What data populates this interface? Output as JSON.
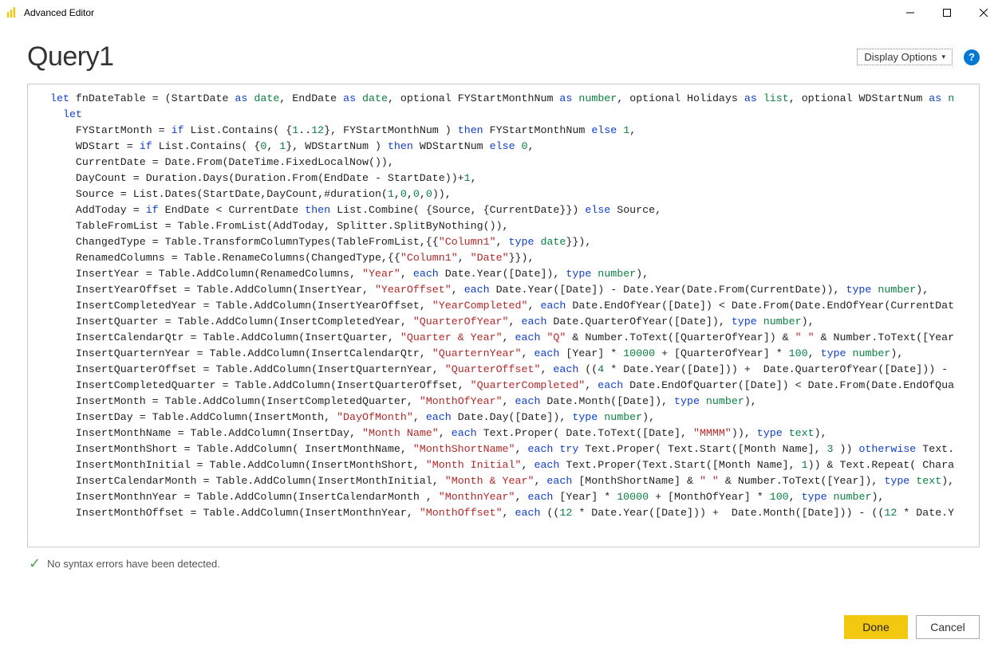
{
  "window": {
    "title": "Advanced Editor"
  },
  "header": {
    "query_name": "Query1",
    "display_options_label": "Display Options"
  },
  "status": {
    "message": "No syntax errors have been detected."
  },
  "buttons": {
    "done": "Done",
    "cancel": "Cancel"
  },
  "code": {
    "lines_html": [
      "<span class='kw'>let</span> fnDateTable = (StartDate <span class='kw'>as</span> <span class='ty'>date</span>, EndDate <span class='kw'>as</span> <span class='ty'>date</span>, optional FYStartMonthNum <span class='kw'>as</span> <span class='ty'>number</span>, optional Holidays <span class='kw'>as</span> <span class='ty'>list</span>, optional WDStartNum <span class='kw'>as</span> <span class='ty'>n</span>",
      "  <span class='kw'>let</span>",
      "    FYStartMonth = <span class='kw'>if</span> List.Contains( {<span class='num'>1</span>..<span class='num'>12</span>}, FYStartMonthNum ) <span class='kw'>then</span> FYStartMonthNum <span class='kw'>else</span> <span class='num'>1</span>,",
      "    WDStart = <span class='kw'>if</span> List.Contains( {<span class='num'>0</span>, <span class='num'>1</span>}, WDStartNum ) <span class='kw'>then</span> WDStartNum <span class='kw'>else</span> <span class='num'>0</span>,",
      "    CurrentDate = Date.From(DateTime.FixedLocalNow()),",
      "    DayCount = Duration.Days(Duration.From(EndDate - StartDate))+<span class='num'>1</span>,",
      "    Source = List.Dates(StartDate,DayCount,#duration(<span class='num'>1</span>,<span class='num'>0</span>,<span class='num'>0</span>,<span class='num'>0</span>)),",
      "    AddToday = <span class='kw'>if</span> EndDate &lt; CurrentDate <span class='kw'>then</span> List.Combine( {Source, {CurrentDate}}) <span class='kw'>else</span> Source,",
      "    TableFromList = Table.FromList(AddToday, Splitter.SplitByNothing()),",
      "    ChangedType = Table.TransformColumnTypes(TableFromList,{{<span class='str'>\"Column1\"</span>, <span class='kw'>type</span> <span class='ty'>date</span>}}),",
      "    RenamedColumns = Table.RenameColumns(ChangedType,{{<span class='str'>\"Column1\"</span>, <span class='str'>\"Date\"</span>}}),",
      "    InsertYear = Table.AddColumn(RenamedColumns, <span class='str'>\"Year\"</span>, <span class='kw'>each</span> Date.Year([Date]), <span class='kw'>type</span> <span class='ty'>number</span>),",
      "    InsertYearOffset = Table.AddColumn(InsertYear, <span class='str'>\"YearOffset\"</span>, <span class='kw'>each</span> Date.Year([Date]) - Date.Year(Date.From(CurrentDate)), <span class='kw'>type</span> <span class='ty'>number</span>),",
      "    InsertCompletedYear = Table.AddColumn(InsertYearOffset, <span class='str'>\"YearCompleted\"</span>, <span class='kw'>each</span> Date.EndOfYear([Date]) &lt; Date.From(Date.EndOfYear(CurrentDat",
      "",
      "    InsertQuarter = Table.AddColumn(InsertCompletedYear, <span class='str'>\"QuarterOfYear\"</span>, <span class='kw'>each</span> Date.QuarterOfYear([Date]), <span class='kw'>type</span> <span class='ty'>number</span>),",
      "    InsertCalendarQtr = Table.AddColumn(InsertQuarter, <span class='str'>\"Quarter &amp; Year\"</span>, <span class='kw'>each</span> <span class='str'>\"Q\"</span> &amp; Number.ToText([QuarterOfYear]) &amp; <span class='str'>\" \"</span> &amp; Number.ToText([Year",
      "    InsertQuarternYear = Table.AddColumn(InsertCalendarQtr, <span class='str'>\"QuarternYear\"</span>, <span class='kw'>each</span> [Year] * <span class='num'>10000</span> + [QuarterOfYear] * <span class='num'>100</span>, <span class='kw'>type</span> <span class='ty'>number</span>),",
      "    InsertQuarterOffset = Table.AddColumn(InsertQuarternYear, <span class='str'>\"QuarterOffset\"</span>, <span class='kw'>each</span> ((<span class='num'>4</span> * Date.Year([Date])) +  Date.QuarterOfYear([Date])) -",
      "    InsertCompletedQuarter = Table.AddColumn(InsertQuarterOffset, <span class='str'>\"QuarterCompleted\"</span>, <span class='kw'>each</span> Date.EndOfQuarter([Date]) &lt; Date.From(Date.EndOfQua",
      "",
      "    InsertMonth = Table.AddColumn(InsertCompletedQuarter, <span class='str'>\"MonthOfYear\"</span>, <span class='kw'>each</span> Date.Month([Date]), <span class='kw'>type</span> <span class='ty'>number</span>),",
      "    InsertDay = Table.AddColumn(InsertMonth, <span class='str'>\"DayOfMonth\"</span>, <span class='kw'>each</span> Date.Day([Date]), <span class='kw'>type</span> <span class='ty'>number</span>),",
      "    InsertMonthName = Table.AddColumn(InsertDay, <span class='str'>\"Month Name\"</span>, <span class='kw'>each</span> Text.Proper( Date.ToText([Date], <span class='str'>\"MMMM\"</span>)), <span class='kw'>type</span> <span class='ty'>text</span>),",
      "    InsertMonthShort = Table.AddColumn( InsertMonthName, <span class='str'>\"MonthShortName\"</span>, <span class='kw'>each</span> <span class='kw'>try</span> Text.Proper( Text.Start([Month Name], <span class='num'>3</span> )) <span class='kw'>otherwise</span> Text.",
      "    InsertMonthInitial = Table.AddColumn(InsertMonthShort, <span class='str'>\"Month Initial\"</span>, <span class='kw'>each</span> Text.Proper(Text.Start([Month Name], <span class='num'>1</span>)) &amp; Text.Repeat( Chara",
      "    InsertCalendarMonth = Table.AddColumn(InsertMonthInitial, <span class='str'>\"Month &amp; Year\"</span>, <span class='kw'>each</span> [MonthShortName] &amp; <span class='str'>\" \"</span> &amp; Number.ToText([Year]), <span class='kw'>type</span> <span class='ty'>text</span>),",
      "    InsertMonthnYear = Table.AddColumn(InsertCalendarMonth , <span class='str'>\"MonthnYear\"</span>, <span class='kw'>each</span> [Year] * <span class='num'>10000</span> + [MonthOfYear] * <span class='num'>100</span>, <span class='kw'>type</span> <span class='ty'>number</span>),",
      "    InsertMonthOffset = Table.AddColumn(InsertMonthnYear, <span class='str'>\"MonthOffset\"</span>, <span class='kw'>each</span> ((<span class='num'>12</span> * Date.Year([Date])) +  Date.Month([Date])) - ((<span class='num'>12</span> * Date.Y"
    ]
  }
}
